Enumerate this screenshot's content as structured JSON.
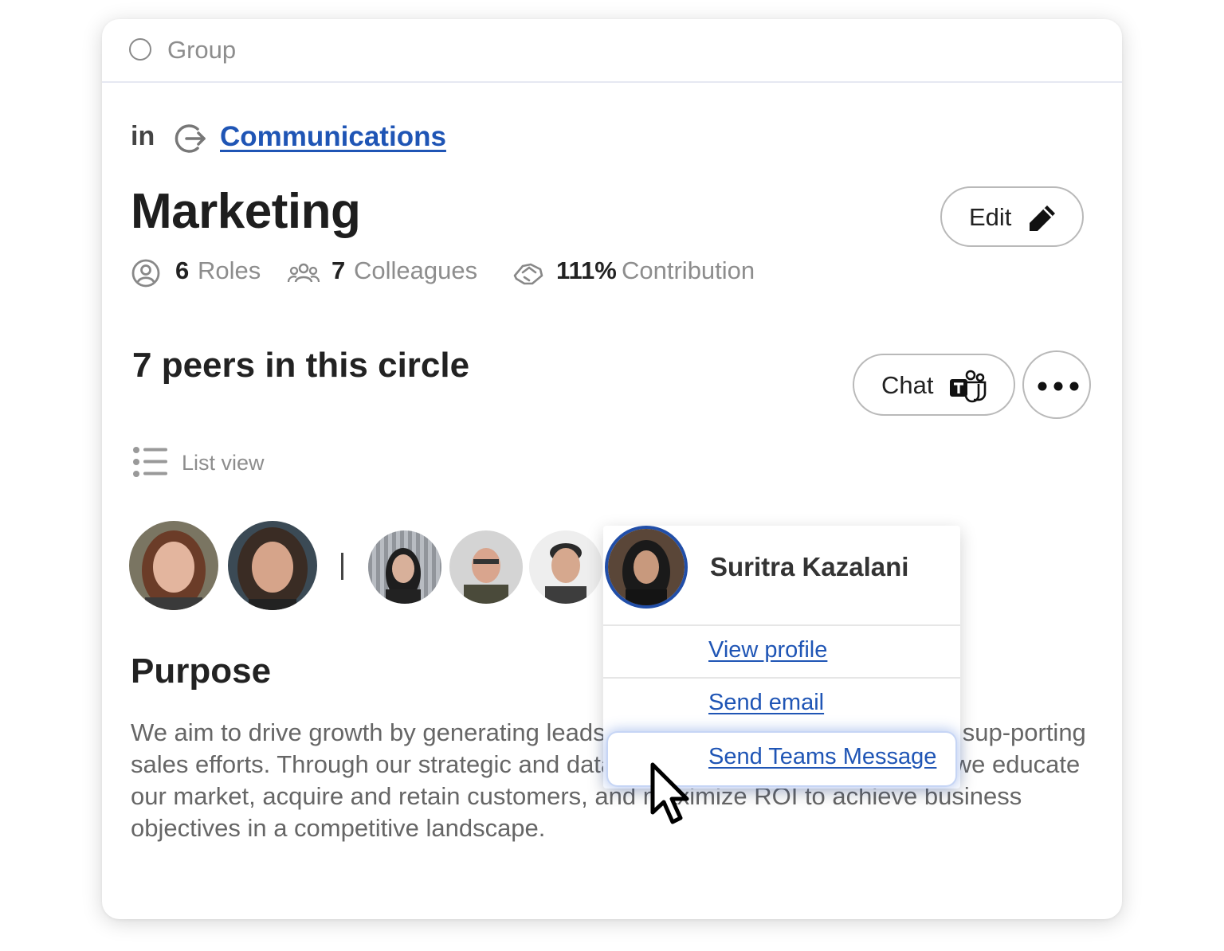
{
  "header": {
    "type_label": "Group"
  },
  "breadcrumb": {
    "prefix": "in",
    "parent_link": "Communications"
  },
  "title": "Marketing",
  "actions": {
    "edit_label": "Edit"
  },
  "stats": {
    "roles": {
      "value": "6",
      "label": "Roles"
    },
    "colleagues": {
      "value": "7",
      "label": "Colleagues"
    },
    "contribution": {
      "value": "111%",
      "label": "Contribution"
    }
  },
  "peers": {
    "title": "7 peers in this circle",
    "chat_label": "Chat",
    "list_view_label": "List view"
  },
  "purpose": {
    "title": "Purpose",
    "text": "We aim to drive growth by generating leads, building brand awareness, and sup-porting sales efforts. Through our strategic and data-driven marketing cam-paigns, we educate our market, acquire and retain customers, and maximize ROI to achieve business objectives in a competitive landscape."
  },
  "popover": {
    "name": "Suritra Kazalani",
    "items": [
      {
        "label": "View profile"
      },
      {
        "label": "Send email"
      },
      {
        "label": "Send Teams Message"
      }
    ]
  },
  "icons": {
    "header": "radio-circle-icon",
    "breadcrumb": "exit-arrow-icon",
    "edit": "pencil-icon",
    "roles": "person-circle-icon",
    "colleagues": "people-icon",
    "contribution": "handshake-icon",
    "chat": "teams-icon",
    "more": "more-dots-icon",
    "list_view": "list-icon",
    "cursor": "mouse-pointer-icon"
  },
  "colors": {
    "link": "#1f55b5",
    "avatar_ring": "#214ea8",
    "muted_text": "#8d8d8d"
  }
}
